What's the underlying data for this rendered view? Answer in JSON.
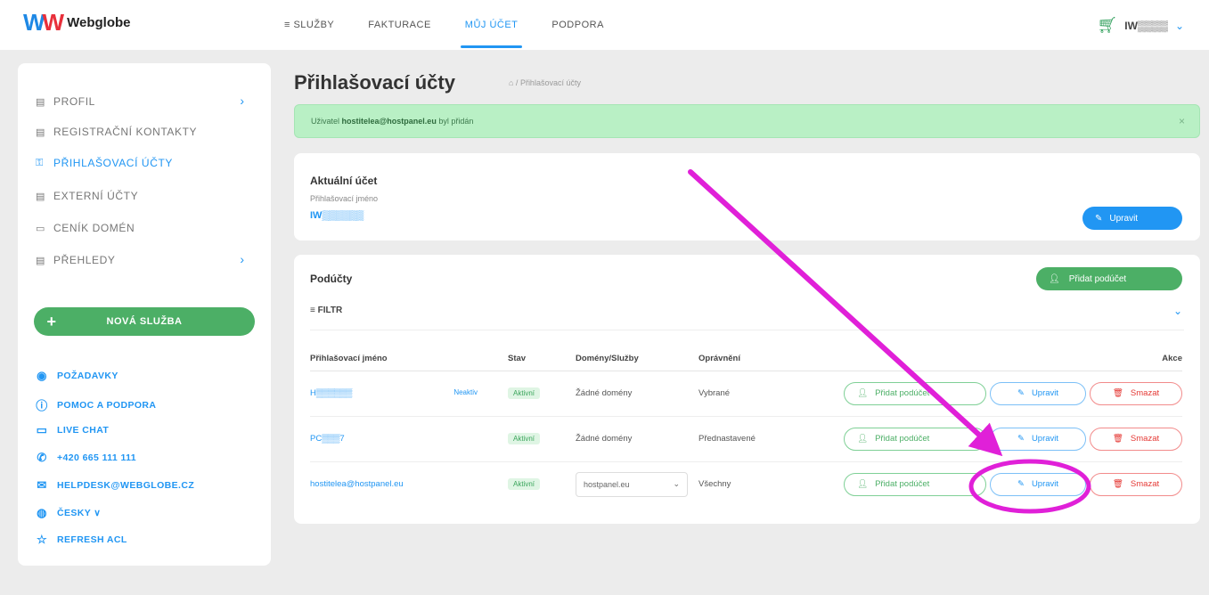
{
  "brand": {
    "name": "Webglobe",
    "mark": "W"
  },
  "nav": [
    {
      "label": "≡ SLUŽBY",
      "active": false
    },
    {
      "label": "FAKTURACE",
      "active": false
    },
    {
      "label": "MŮJ ÚČET",
      "active": true
    },
    {
      "label": "PODPORA",
      "active": false
    }
  ],
  "user": {
    "name": "IW▒▒▒▒",
    "cart_icon": "cart-icon"
  },
  "sidebar": {
    "items": [
      {
        "label": "PROFIL",
        "icon": "user-icon",
        "glyph": "▤",
        "has_chevron": true,
        "active": false
      },
      {
        "label": "REGISTRAČNÍ KONTAKTY",
        "icon": "contacts-icon",
        "glyph": "▤",
        "has_chevron": false,
        "active": false
      },
      {
        "label": "PŘIHLAŠOVACÍ ÚČTY",
        "icon": "key-icon",
        "glyph": "⚿",
        "has_chevron": false,
        "active": true
      },
      {
        "label": "EXTERNÍ ÚČTY",
        "icon": "external-icon",
        "glyph": "▤",
        "has_chevron": false,
        "active": false
      },
      {
        "label": "CENÍK DOMÉN",
        "icon": "pricelist-icon",
        "glyph": "▭",
        "has_chevron": false,
        "active": false
      },
      {
        "label": "PŘEHLEDY",
        "icon": "reports-icon",
        "glyph": "▤",
        "has_chevron": true,
        "active": false
      }
    ],
    "new_service": "NOVÁ SLUŽBA",
    "help": [
      {
        "label": "POŽADAVKY",
        "icon": "requests-icon",
        "glyph": "◉"
      },
      {
        "label": "POMOC A PODPORA",
        "icon": "help-icon",
        "glyph": "ⓘ"
      },
      {
        "label": "LIVE CHAT",
        "icon": "chat-icon",
        "glyph": "▭"
      },
      {
        "label": "+420 665 111 111",
        "icon": "phone-icon",
        "glyph": "✆"
      },
      {
        "label": "HELPDESK@WEBGLOBE.CZ",
        "icon": "email-icon",
        "glyph": "✉"
      },
      {
        "label": "ČESKY ∨",
        "icon": "globe-icon",
        "glyph": "◍"
      },
      {
        "label": "REFRESH ACL",
        "icon": "refresh-icon",
        "glyph": "☆"
      }
    ]
  },
  "main": {
    "title": "Přihlašovací účty",
    "breadcrumb": "⌂ / Přihlašovací účty",
    "alert": {
      "prefix": "Uživatel ",
      "email": "hostitelea@hostpanel.eu",
      "suffix": " byl přidán",
      "close": "×"
    },
    "current": {
      "title": "Aktuální účet",
      "label": "Přihlašovací jméno",
      "value": "IW▒▒▒▒▒▒",
      "edit": "Upravit"
    },
    "subaccounts": {
      "title": "Podúčty",
      "add": "Přidat podúčet",
      "filter": "≡ FILTR",
      "columns": [
        "Přihlašovací jméno",
        "Stav",
        "Domény/Služby",
        "Oprávnění",
        "Akce"
      ],
      "rows": [
        {
          "login": "H▒▒▒▒▒▒",
          "note": "Neaktiv",
          "status": "Aktivní",
          "domains": "Žádné domény",
          "select": false,
          "permission": "Vybrané"
        },
        {
          "login": "PC▒▒▒7",
          "note": "",
          "status": "Aktivní",
          "domains": "Žádné domény",
          "select": false,
          "permission": "Přednastavené"
        },
        {
          "login": "hostitelea@hostpanel.eu",
          "note": "",
          "status": "Aktivní",
          "domains": "hostpanel.eu",
          "select": true,
          "permission": "Všechny"
        }
      ],
      "row_actions": {
        "add": "Přidat podúčet",
        "edit": "Upravit",
        "delete": "Smazat"
      }
    }
  },
  "annotation": {
    "color": "#e020d8"
  }
}
